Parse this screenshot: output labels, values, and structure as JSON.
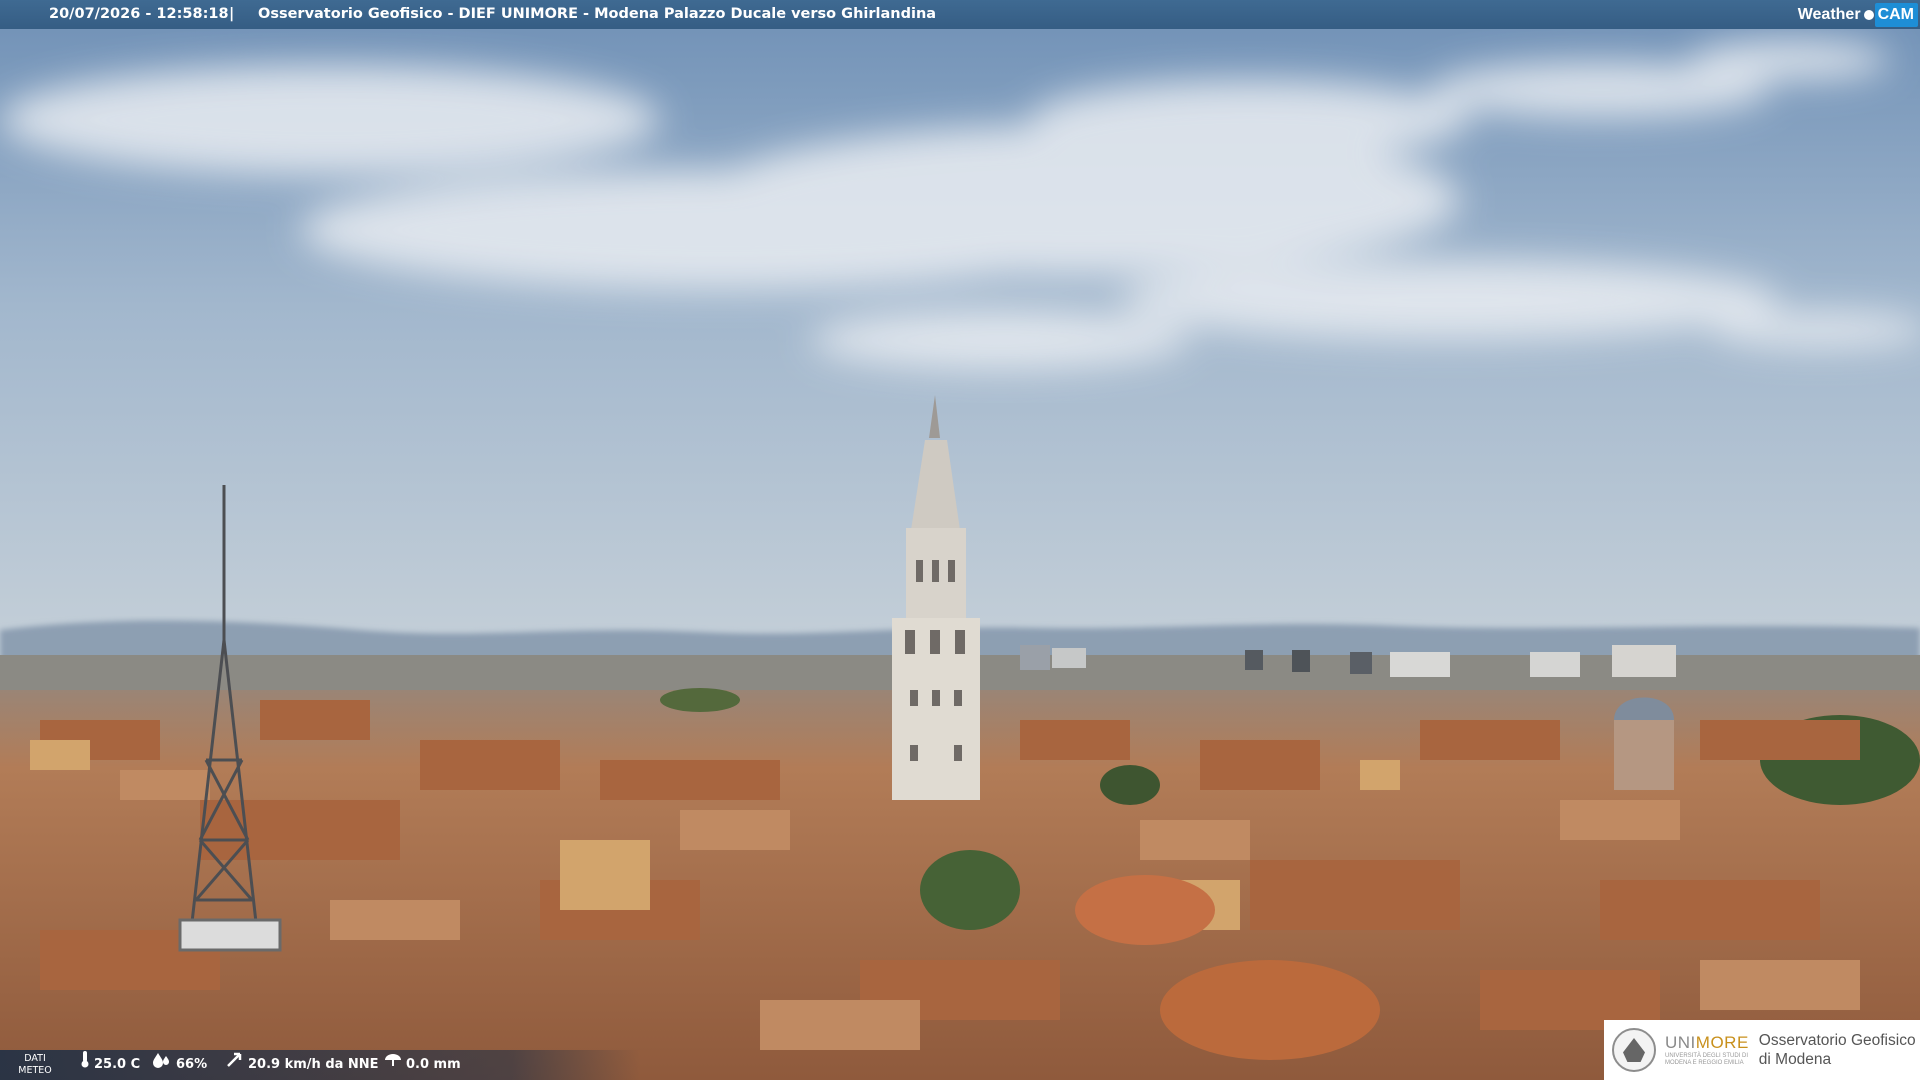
{
  "header": {
    "datetime": "20/07/2026 - 12:58:18",
    "separator": "|",
    "title": "Osservatorio Geofisico - DIEF UNIMORE - Modena Palazzo Ducale verso Ghirlandina",
    "brand_weather": "Weather",
    "brand_cam": "CAM"
  },
  "meteo": {
    "label_line1": "DATI",
    "label_line2": "METEO",
    "temperature": "25.0 C",
    "humidity": "66%",
    "wind": "20.9 km/h da NNE",
    "rain": "0.0 mm",
    "icons": [
      "thermometer-icon",
      "humidity-icon",
      "wind-icon",
      "rain-icon"
    ]
  },
  "logo": {
    "uni_prefix": "UNI",
    "uni_suffix": "MORE",
    "uni_small_1": "UNIVERSITÀ DEGLI STUDI DI",
    "uni_small_2": "MODENA E REGGIO EMILIA",
    "observatory_line1": "Osservatorio Geofisico",
    "observatory_line2": "di Modena"
  },
  "colors": {
    "header_bar": "#355d84",
    "cam_badge": "#1e8ed6",
    "unimore_accent": "#c8901c",
    "sky": "#9fb6cf",
    "roof": "#b67a52"
  }
}
